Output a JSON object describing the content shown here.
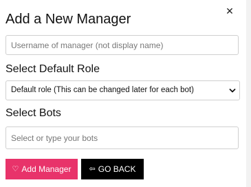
{
  "dialog": {
    "title": "Add a New Manager",
    "close_glyph": "✕"
  },
  "username": {
    "placeholder": "Username of manager (not display name)",
    "value": ""
  },
  "role": {
    "label": "Select Default Role",
    "selected": "Default role (This can be changed later for each bot)"
  },
  "bots": {
    "label": "Select Bots",
    "placeholder": "Select or type your bots",
    "value": ""
  },
  "actions": {
    "add_label": "Add Manager",
    "add_icon": "heart-outline-icon",
    "add_icon_glyph": "♡",
    "add_color": "#e8336a",
    "back_label": "GO BACK",
    "back_icon": "arrow-left-icon",
    "back_icon_glyph": "⇦",
    "back_color": "#000000"
  }
}
